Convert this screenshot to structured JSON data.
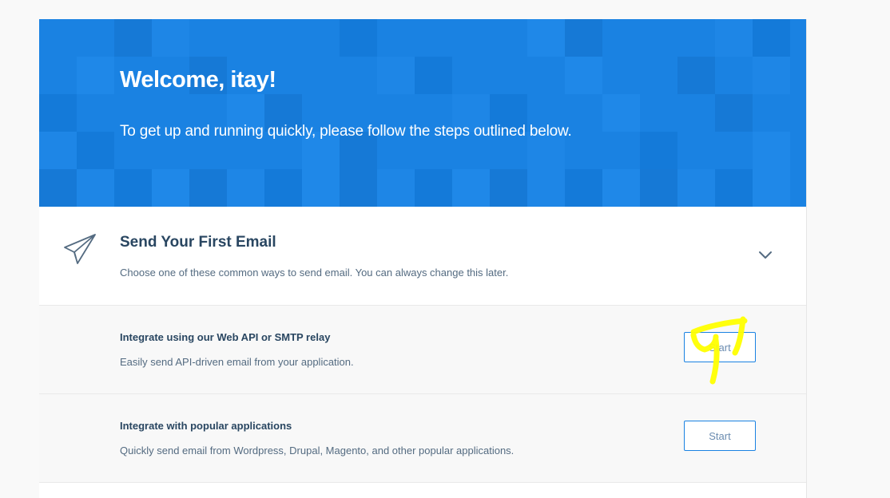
{
  "hero": {
    "title": "Welcome, itay!",
    "subtitle": "To get up and running quickly, please follow the steps outlined below."
  },
  "section": {
    "icon": "paper-plane-icon",
    "title": "Send Your First Email",
    "subtitle": "Choose one of these common ways to send email. You can always change this later.",
    "toggle_icon": "chevron-down-icon"
  },
  "options": [
    {
      "title": "Integrate using our Web API or SMTP relay",
      "description": "Easily send API-driven email from your application.",
      "button_label": "Start"
    },
    {
      "title": "Integrate with popular applications",
      "description": "Quickly send email from Wordpress, Drupal, Magento, and other popular applications.",
      "button_label": "Start"
    }
  ],
  "colors": {
    "hero_background": "#1a82e2",
    "heading": "#294661",
    "body_text": "#546b81",
    "button_border": "#1a82e2",
    "annotation_highlight": "#ffff00"
  }
}
